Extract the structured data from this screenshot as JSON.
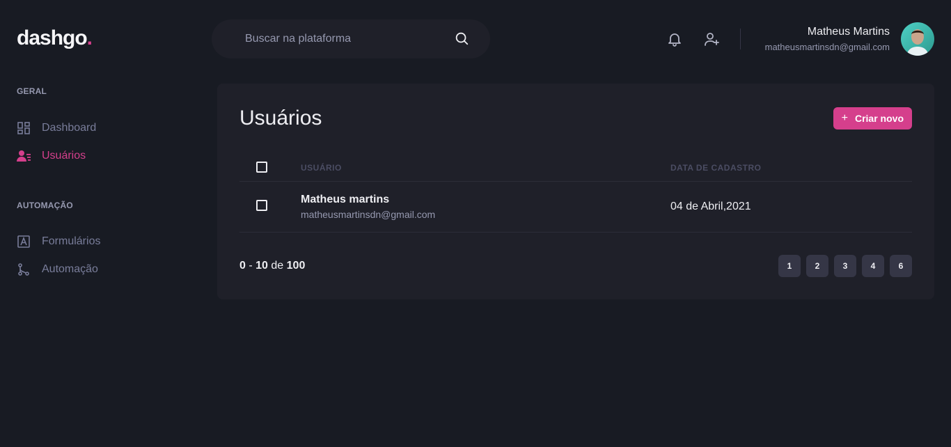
{
  "header": {
    "logo_text": "dashgo",
    "logo_dot": ".",
    "search_placeholder": "Buscar na plataforma",
    "user_name": "Matheus Martins",
    "user_email": "matheusmartinsdn@gmail.com",
    "icons": [
      "notification-bell-icon",
      "add-user-icon",
      "search-icon"
    ]
  },
  "sidebar": {
    "sections": [
      {
        "title": "GERAL",
        "items": [
          {
            "label": "Dashboard",
            "icon": "dashboard-icon",
            "active": false
          },
          {
            "label": "Usuários",
            "icon": "users-icon",
            "active": true
          }
        ]
      },
      {
        "title": "AUTOMAÇÃO",
        "items": [
          {
            "label": "Formulários",
            "icon": "form-icon",
            "active": false
          },
          {
            "label": "Automação",
            "icon": "git-branch-icon",
            "active": false
          }
        ]
      }
    ]
  },
  "main": {
    "title": "Usuários",
    "create_button": {
      "icon": "+",
      "label": "Criar novo"
    },
    "table": {
      "columns": [
        "USUÁRIO",
        "DATA DE CADASTRO"
      ],
      "rows": [
        {
          "name": "Matheus martins",
          "email": "matheusmartinsdn@gmail.com",
          "date": "04 de Abril,2021"
        }
      ]
    },
    "pagination": {
      "from": "0",
      "separator": "-",
      "to": "10",
      "of_label": "de",
      "total": "100",
      "pages": [
        "1",
        "2",
        "3",
        "4",
        "6"
      ]
    }
  },
  "colors": {
    "background": "#181b23",
    "surface": "#1f2029",
    "accent": "#d53f8c",
    "muted_text": "#9699b0"
  }
}
